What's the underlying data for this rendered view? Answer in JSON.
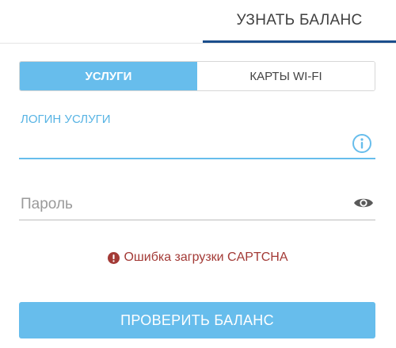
{
  "tabs": {
    "active_label": "УЗНАТЬ БАЛАНС"
  },
  "segmented": {
    "options": [
      "УСЛУГИ",
      "КАРТЫ WI-FI"
    ],
    "selected": "УСЛУГИ"
  },
  "login": {
    "label": "ЛОГИН УСЛУГИ",
    "value": ""
  },
  "password": {
    "placeholder": "Пароль",
    "value": ""
  },
  "error": {
    "message": "Ошибка загрузки CAPTCHA"
  },
  "submit": {
    "label": "ПРОВЕРИТЬ БАЛАНС"
  },
  "icons": {
    "info": "info-icon",
    "eye": "eye-icon",
    "error": "exclamation-circle-icon"
  },
  "colors": {
    "accent": "#67bdec",
    "tab_indicator": "#1b4e8c",
    "error": "#a33a36"
  }
}
